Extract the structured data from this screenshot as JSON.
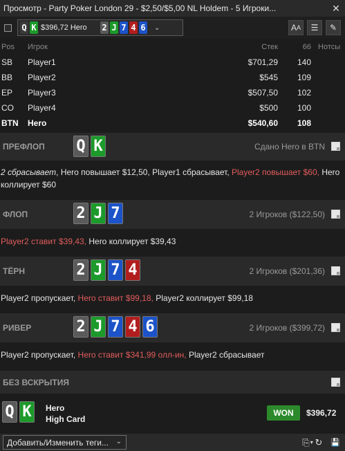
{
  "window": {
    "title": "Просмотр - Party Poker London 29 - $2,50/$5,00 NL Holdem - 5 Игроки...",
    "close_glyph": "✕"
  },
  "toolbar": {
    "selector": {
      "hole_cards": [
        {
          "rank": "Q",
          "suit": "dark"
        },
        {
          "rank": "K",
          "suit": "green"
        }
      ],
      "amount_label": "$396,72 Hero",
      "board": [
        {
          "rank": "2",
          "suit": "gray"
        },
        {
          "rank": "J",
          "suit": "green"
        },
        {
          "rank": "7",
          "suit": "blue"
        },
        {
          "rank": "4",
          "suit": "red"
        },
        {
          "rank": "6",
          "suit": "blue"
        }
      ]
    },
    "buttons": {
      "font": "A",
      "font_small": "A",
      "list": "☰",
      "edit": "✎"
    }
  },
  "players": {
    "headers": {
      "pos": "Pos",
      "player": "Игрок",
      "stack": "Стек",
      "hands": "66",
      "notes": "Нотсы"
    },
    "rows": [
      {
        "pos": "SB",
        "name": "Player1",
        "stack": "$701,29",
        "hands": "140"
      },
      {
        "pos": "BB",
        "name": "Player2",
        "stack": "$545",
        "hands": "109"
      },
      {
        "pos": "EP",
        "name": "Player3",
        "stack": "$507,50",
        "hands": "102"
      },
      {
        "pos": "CO",
        "name": "Player4",
        "stack": "$500",
        "hands": "100"
      },
      {
        "pos": "BTN",
        "name": "Hero",
        "stack": "$540,60",
        "hands": "108"
      }
    ]
  },
  "streets": {
    "preflop": {
      "label": "ПРЕФЛОП",
      "info": "Сдано Hero в BTN",
      "cards": [
        {
          "rank": "Q",
          "suit": "gray"
        },
        {
          "rank": "K",
          "suit": "green"
        }
      ],
      "actions": [
        {
          "text": "2 сбрасывает",
          "highlight": false,
          "italic": true
        },
        {
          "text": ", Hero повышает $12,50, Player1 сбрасывает, ",
          "highlight": false
        },
        {
          "text": "Player2 повышает $60,",
          "highlight": true
        },
        {
          "text": " Hero коллирует $60",
          "highlight": false
        }
      ]
    },
    "flop": {
      "label": "ФЛОП",
      "info": "2 Игроков ($122,50)",
      "cards": [
        {
          "rank": "2",
          "suit": "gray"
        },
        {
          "rank": "J",
          "suit": "green"
        },
        {
          "rank": "7",
          "suit": "blue"
        }
      ],
      "actions": [
        {
          "text": "Player2 ставит $39,43,",
          "highlight": true
        },
        {
          "text": " Hero коллирует $39,43",
          "highlight": false
        }
      ]
    },
    "turn": {
      "label": "ТЁРН",
      "info": "2 Игроков ($201,36)",
      "cards": [
        {
          "rank": "2",
          "suit": "gray"
        },
        {
          "rank": "J",
          "suit": "green"
        },
        {
          "rank": "7",
          "suit": "blue"
        },
        {
          "rank": "4",
          "suit": "red"
        }
      ],
      "actions": [
        {
          "text": "Player2 пропускает, ",
          "highlight": false
        },
        {
          "text": "Hero ставит $99,18,",
          "highlight": true
        },
        {
          "text": " Player2 коллирует $99,18",
          "highlight": false
        }
      ]
    },
    "river": {
      "label": "РИВЕР",
      "info": "2 Игроков ($399,72)",
      "cards": [
        {
          "rank": "2",
          "suit": "gray"
        },
        {
          "rank": "J",
          "suit": "green"
        },
        {
          "rank": "7",
          "suit": "blue"
        },
        {
          "rank": "4",
          "suit": "red"
        },
        {
          "rank": "6",
          "suit": "blue"
        }
      ],
      "actions": [
        {
          "text": "Player2 пропускает, ",
          "highlight": false
        },
        {
          "text": "Hero ставит $341,99 олл-ин,",
          "highlight": true
        },
        {
          "text": " Player2 сбрасывает",
          "highlight": false
        }
      ]
    },
    "showdown": {
      "label": "БЕЗ ВСКРЫТИЯ"
    }
  },
  "result": {
    "cards": [
      {
        "rank": "Q",
        "suit": "gray"
      },
      {
        "rank": "K",
        "suit": "green"
      }
    ],
    "player": "Hero",
    "hand": "High Card",
    "badge": "WON",
    "amount": "$396,72"
  },
  "footer": {
    "tag_select": "Добавить/Изменить теги...",
    "copy_glyph": "⎘",
    "refresh_glyph": "↻",
    "save_glyph": "💾"
  },
  "colors": {
    "gray": "#5a5a5a",
    "green": "#1c9a2a",
    "red": "#b21e1e",
    "blue": "#1c53c8",
    "dark": "#3a3a3a",
    "won": "#2c8a2c",
    "highlight": "#e25c5c"
  }
}
